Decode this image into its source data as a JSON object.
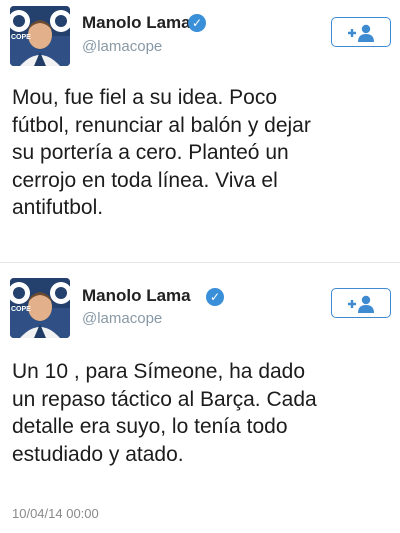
{
  "tweets": [
    {
      "name": "Manolo Lama",
      "handle": "@lamacope",
      "avatar_text": "COPE",
      "text": "Mou, fue fiel a su idea. Poco\nfútbol, renunciar al balón y dejar\nsu portería a cero. Planteó un\ncerrojo en toda línea. Viva el\nantifutbol."
    },
    {
      "name": "Manolo Lama",
      "handle": "@lamacope",
      "avatar_text": "COPE",
      "text": "Un 10 , para Símeone, ha dado\nun repaso táctico al Barça. Cada\ndetalle era suyo, lo tenía todo\nestudiado y atado.",
      "timestamp": "10/04/14 00:00"
    }
  ],
  "icons": {
    "verified": "verified-badge-icon",
    "follow": "add-user-icon"
  },
  "colors": {
    "verified": "#3a8fd9",
    "follow_border": "#3f8bd2",
    "handle": "#8899a6"
  }
}
